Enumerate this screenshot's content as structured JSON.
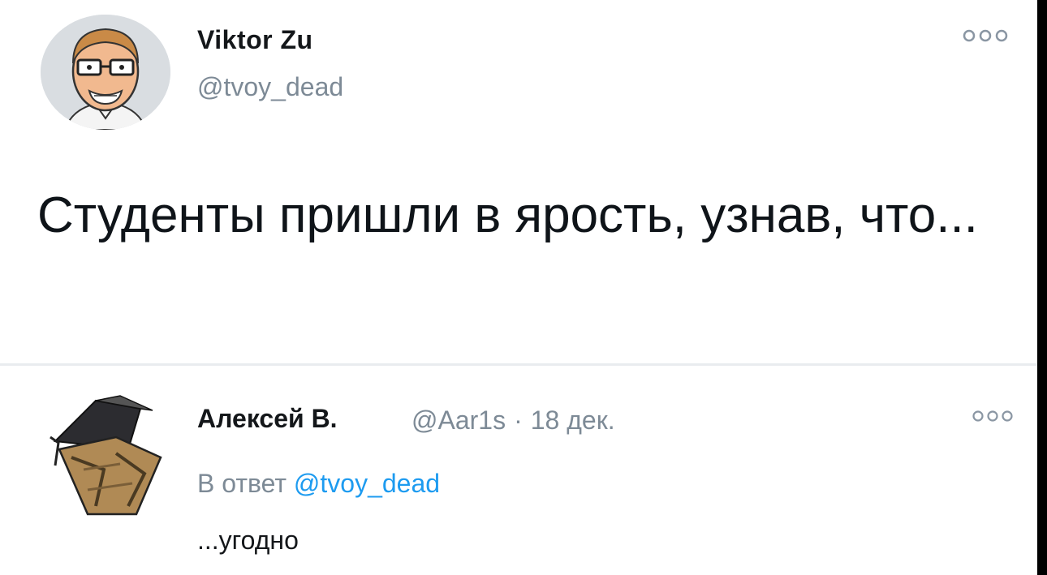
{
  "tweet": {
    "author_name": "Viktor Zu",
    "author_handle": "@tvoy_dead",
    "text": "Студенты пришли в ярость, узнав, что...",
    "more_icon": "more-options-icon"
  },
  "reply": {
    "author_name": "Алексей В.",
    "author_handle": "@Aar1s",
    "separator": "·",
    "date": "18 дек.",
    "reply_to_prefix": "В ответ",
    "reply_to_handle": "@tvoy_dead",
    "text": "...угодно",
    "more_icon": "more-options-icon"
  },
  "colors": {
    "text": "#14171a",
    "secondary": "#7d8a96",
    "mention": "#1d9bf0",
    "divider": "#e9ecef"
  }
}
